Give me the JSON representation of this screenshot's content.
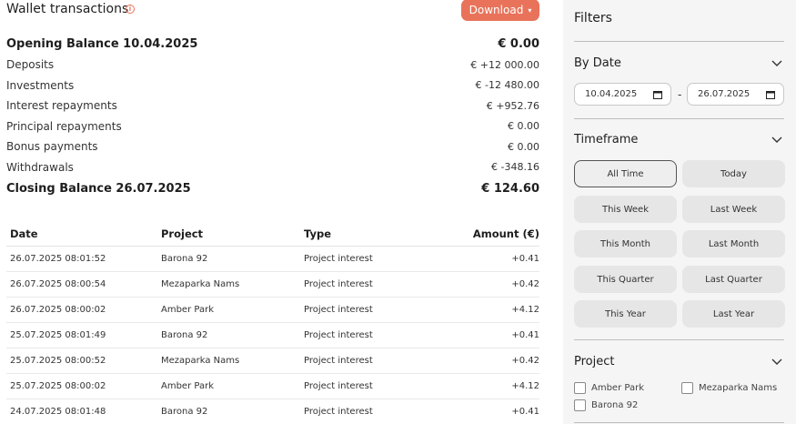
{
  "header": {
    "title": "Wallet transactions",
    "info_icon": "info-circle-icon",
    "download_label": "Download",
    "download_caret": "▾"
  },
  "colors": {
    "accent": "#e8735a",
    "panel_bg": "#f5f5f5"
  },
  "summary": {
    "opening_label": "Opening Balance 10.04.2025",
    "opening_amount": "€ 0.00",
    "rows": [
      {
        "label": "Deposits",
        "amount": "€ +12 000.00"
      },
      {
        "label": "Investments",
        "amount": "€ -12 480.00"
      },
      {
        "label": "Interest repayments",
        "amount": "€ +952.76"
      },
      {
        "label": "Principal repayments",
        "amount": "€ 0.00"
      },
      {
        "label": "Bonus payments",
        "amount": "€ 0.00"
      },
      {
        "label": "Withdrawals",
        "amount": "€ -348.16"
      }
    ],
    "closing_label": "Closing Balance 26.07.2025",
    "closing_amount": "€ 124.60"
  },
  "table": {
    "headers": {
      "date": "Date",
      "project": "Project",
      "type": "Type",
      "amount": "Amount (€)"
    },
    "rows": [
      {
        "date": "26.07.2025 08:01:52",
        "project": "Barona 92",
        "type": "Project interest",
        "amount": "+0.41"
      },
      {
        "date": "26.07.2025 08:00:54",
        "project": "Mezaparka Nams",
        "type": "Project interest",
        "amount": "+0.42"
      },
      {
        "date": "26.07.2025 08:00:02",
        "project": "Amber Park",
        "type": "Project interest",
        "amount": "+4.12"
      },
      {
        "date": "25.07.2025 08:01:49",
        "project": "Barona 92",
        "type": "Project interest",
        "amount": "+0.41"
      },
      {
        "date": "25.07.2025 08:00:52",
        "project": "Mezaparka Nams",
        "type": "Project interest",
        "amount": "+0.42"
      },
      {
        "date": "25.07.2025 08:00:02",
        "project": "Amber Park",
        "type": "Project interest",
        "amount": "+4.12"
      },
      {
        "date": "24.07.2025 08:01:48",
        "project": "Barona 92",
        "type": "Project interest",
        "amount": "+0.41"
      }
    ]
  },
  "filters": {
    "title": "Filters",
    "by_date": {
      "label": "By Date",
      "from": "10.04.2025",
      "to": "26.07.2025",
      "separator": "-"
    },
    "timeframe": {
      "label": "Timeframe",
      "options": [
        "All Time",
        "Today",
        "This Week",
        "Last Week",
        "This Month",
        "Last Month",
        "This Quarter",
        "Last Quarter",
        "This Year",
        "Last Year"
      ],
      "selected": "All Time"
    },
    "project": {
      "label": "Project",
      "options": [
        "Amber Park",
        "Mezaparka Nams",
        "Barona 92"
      ]
    }
  }
}
